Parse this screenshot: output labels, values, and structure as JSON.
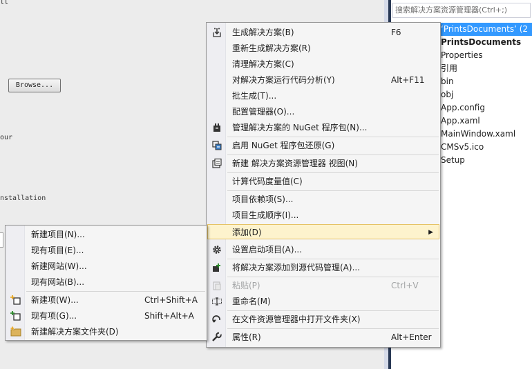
{
  "designer": {
    "fragment_top": "ll",
    "browse_label": "Browse...",
    "fragment_our": "our",
    "fragment_installation": "nstallation"
  },
  "solution_explorer": {
    "search_placeholder": "搜索解决方案资源管理器(Ctrl+;)",
    "items": [
      {
        "label": "‘PrintsDocuments’ (2",
        "selected": true
      },
      {
        "label": "PrintsDocuments",
        "bold": true
      },
      {
        "label": "Properties"
      },
      {
        "label": "引用"
      },
      {
        "label": "bin"
      },
      {
        "label": "obj"
      },
      {
        "label": "App.config"
      },
      {
        "label": "App.xaml"
      },
      {
        "label": "MainWindow.xaml"
      },
      {
        "label": "CMSv5.ico"
      },
      {
        "label": "Setup"
      }
    ]
  },
  "context_menu": {
    "items": [
      {
        "label": "生成解决方案(B)",
        "shortcut": "F6",
        "icon": "build-icon"
      },
      {
        "label": "重新生成解决方案(R)",
        "shortcut": ""
      },
      {
        "label": "清理解决方案(C)",
        "shortcut": ""
      },
      {
        "label": "对解决方案运行代码分析(Y)",
        "shortcut": "Alt+F11"
      },
      {
        "label": "批生成(T)...",
        "shortcut": ""
      },
      {
        "label": "配置管理器(O)...",
        "shortcut": ""
      },
      {
        "label": "管理解决方案的 NuGet 程序包(N)...",
        "shortcut": "",
        "icon": "nuget-icon"
      },
      {
        "label": "启用 NuGet 程序包还原(G)",
        "shortcut": "",
        "icon": "package-restore-icon"
      },
      {
        "label": "新建 解决方案资源管理器 视图(N)",
        "shortcut": "",
        "icon": "new-view-icon"
      },
      {
        "label": "计算代码度量值(C)",
        "shortcut": ""
      },
      {
        "label": "项目依赖项(S)...",
        "shortcut": ""
      },
      {
        "label": "项目生成顺序(I)...",
        "shortcut": ""
      },
      {
        "label": "添加(D)",
        "shortcut": "",
        "submenu": true
      },
      {
        "label": "设置启动项目(A)...",
        "shortcut": "",
        "icon": "gear-icon"
      },
      {
        "label": "将解决方案添加到源代码管理(A)...",
        "shortcut": "",
        "icon": "source-control-icon"
      },
      {
        "label": "粘贴(P)",
        "shortcut": "Ctrl+V",
        "icon": "paste-icon",
        "disabled": true
      },
      {
        "label": "重命名(M)",
        "shortcut": "",
        "icon": "rename-icon"
      },
      {
        "label": "在文件资源管理器中打开文件夹(X)",
        "shortcut": "",
        "icon": "open-folder-arrow-icon"
      },
      {
        "label": "属性(R)",
        "shortcut": "Alt+Enter",
        "icon": "wrench-icon"
      }
    ]
  },
  "add_submenu": {
    "items": [
      {
        "label": "新建项目(N)...",
        "shortcut": ""
      },
      {
        "label": "现有项目(E)...",
        "shortcut": ""
      },
      {
        "label": "新建网站(W)...",
        "shortcut": ""
      },
      {
        "label": "现有网站(B)...",
        "shortcut": ""
      },
      {
        "label": "新建项(W)...",
        "shortcut": "Ctrl+Shift+A",
        "icon": "new-item-icon"
      },
      {
        "label": "现有项(G)...",
        "shortcut": "Shift+Alt+A",
        "icon": "existing-item-icon"
      },
      {
        "label": "新建解决方案文件夹(D)",
        "shortcut": "",
        "icon": "solution-folder-icon"
      }
    ]
  },
  "colors": {
    "selection": "#3399ff",
    "hover": "#fdf3cd",
    "menu_bg": "#f5f5f5"
  }
}
